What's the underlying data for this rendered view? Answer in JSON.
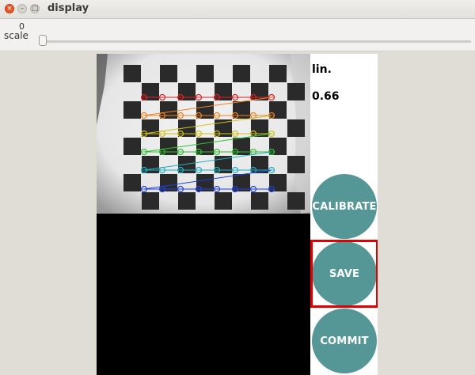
{
  "window": {
    "title": "display"
  },
  "trackbar": {
    "label": "scale",
    "value": "0"
  },
  "hud": {
    "line1": "lin.",
    "line2": "0.66"
  },
  "buttons": {
    "calibrate": "CALIBRATE",
    "save": "SAVE",
    "commit": "COMMIT"
  },
  "colors": {
    "button": "#559696",
    "highlight": "#e00000"
  },
  "icons": {
    "close": "close-icon",
    "minimize": "minimize-icon",
    "maximize": "maximize-icon"
  }
}
